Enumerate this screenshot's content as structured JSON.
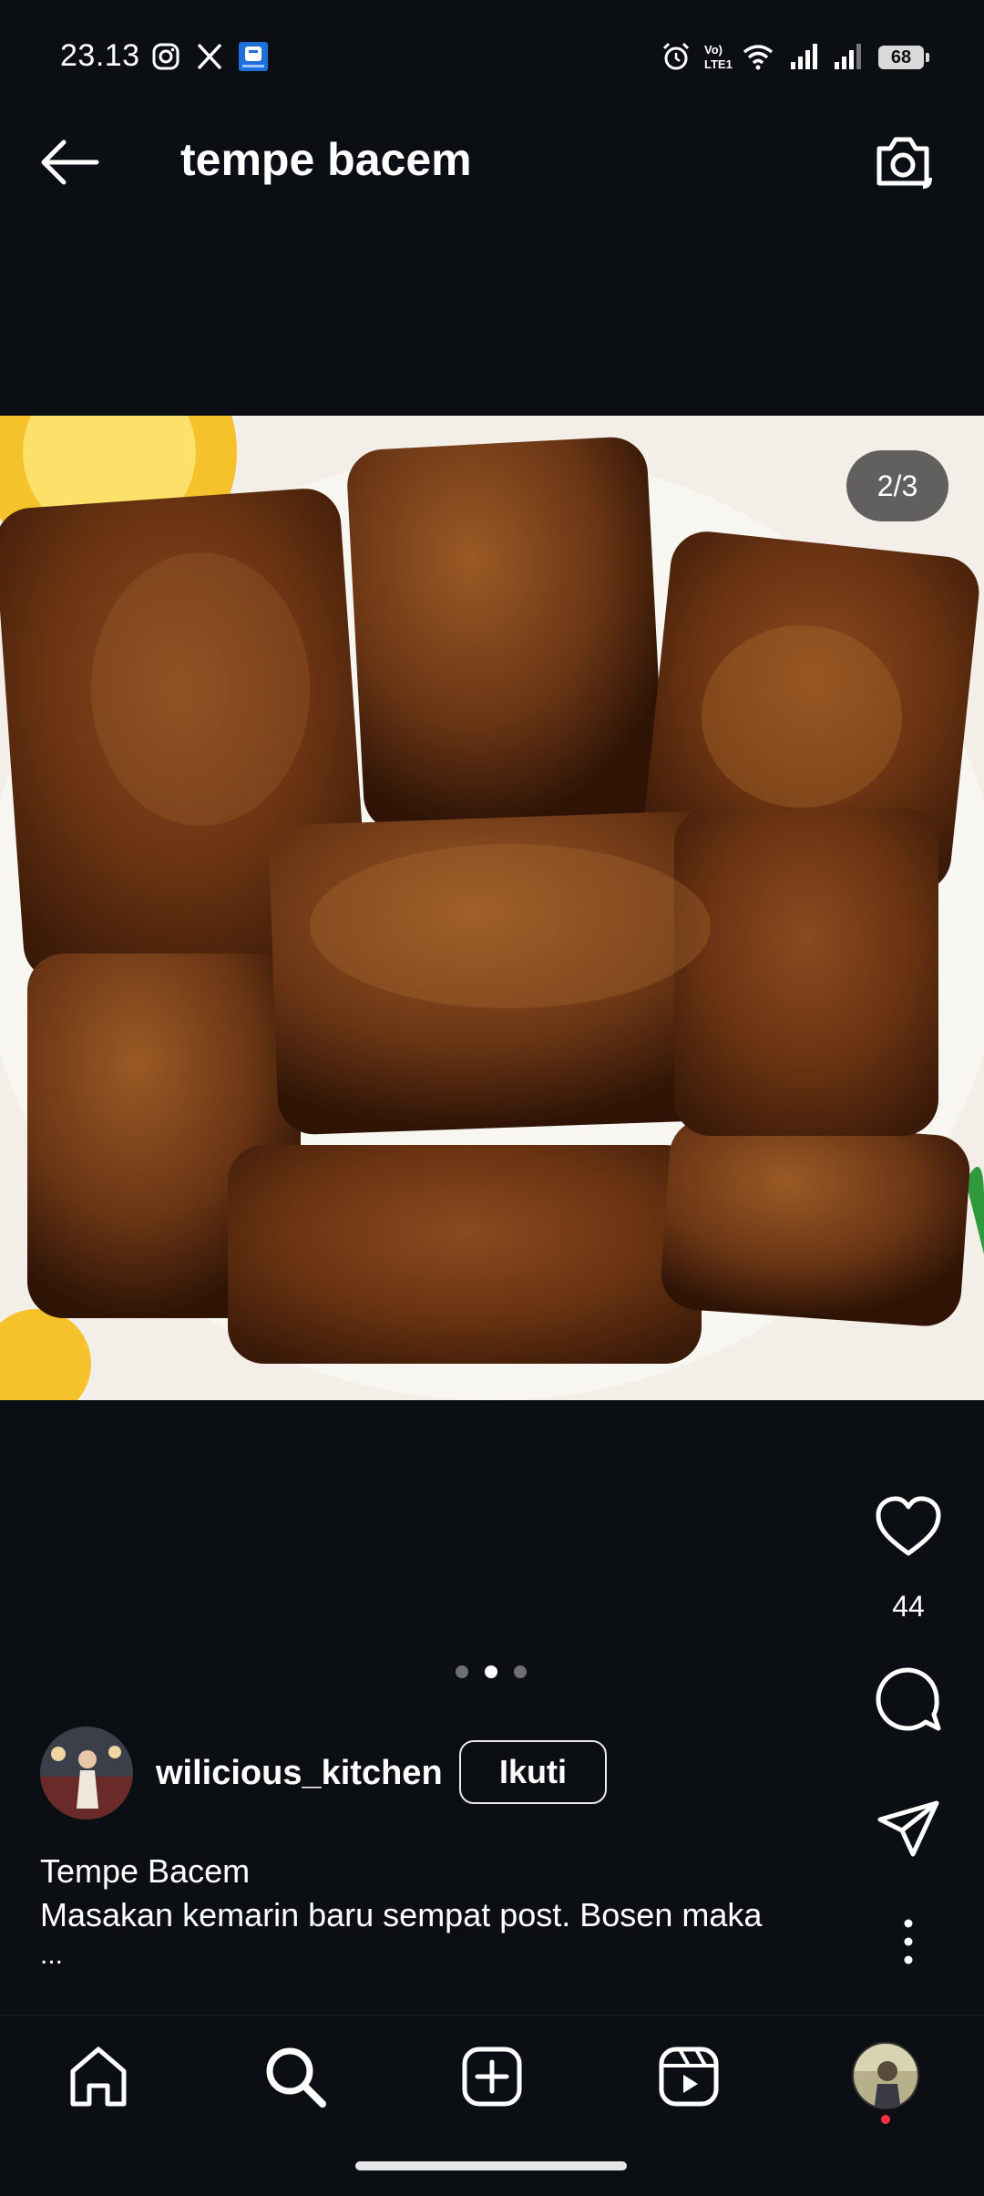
{
  "status_bar": {
    "time": "23.13",
    "battery": "68",
    "icons": [
      "instagram-icon",
      "x-icon",
      "app-notification-icon",
      "alarm-icon",
      "volte-icon",
      "wifi-icon",
      "signal-icon",
      "signal-icon",
      "battery-icon"
    ]
  },
  "header": {
    "title": "tempe bacem",
    "back_icon": "arrow-left-icon",
    "camera_icon": "camera-icon"
  },
  "post": {
    "counter": "2/3",
    "likes": "44",
    "carousel_total": 3,
    "carousel_active_index": 1,
    "author": "wilicious_kitchen",
    "follow_label": "Ikuti",
    "caption_title": "Tempe Bacem",
    "caption_body": "Masakan kemarin baru sempat post. Bosen maka",
    "caption_more": "..."
  },
  "bottom_nav": {
    "items": [
      "home-icon",
      "search-icon",
      "create-icon",
      "reels-icon",
      "profile-avatar"
    ]
  },
  "colors": {
    "background": "#0b0f14",
    "text": "#ffffff",
    "notification_dot": "#ff3040"
  }
}
